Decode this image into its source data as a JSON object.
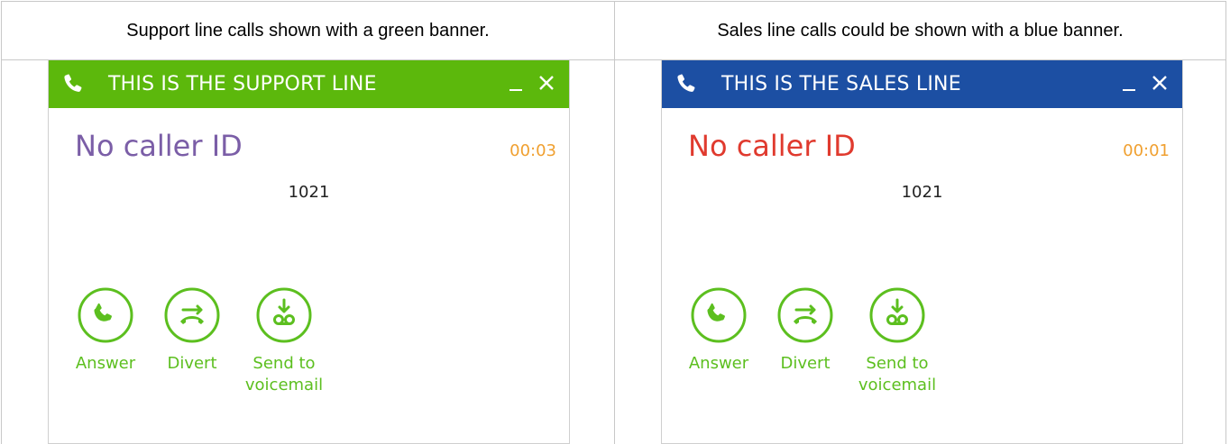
{
  "panels": [
    {
      "caption": "Support line calls shown with a green banner.",
      "banner_title": "THIS IS THE SUPPORT LINE",
      "banner_color": "#5cb80c",
      "caller_name": "No caller ID",
      "caller_name_color": "#7b5ea7",
      "timer": "00:03",
      "number": "1021",
      "actions": [
        {
          "label": "Answer",
          "icon": "answer-phone-icon"
        },
        {
          "label": "Divert",
          "icon": "divert-icon"
        },
        {
          "label": "Send to\nvoicemail",
          "icon": "voicemail-icon"
        }
      ]
    },
    {
      "caption": "Sales line calls could be shown with a blue banner.",
      "banner_title": "THIS IS THE SALES LINE",
      "banner_color": "#1c4fa3",
      "caller_name": "No caller ID",
      "caller_name_color": "#e03a2e",
      "timer": "00:01",
      "number": "1021",
      "actions": [
        {
          "label": "Answer",
          "icon": "answer-phone-icon"
        },
        {
          "label": "Divert",
          "icon": "divert-icon"
        },
        {
          "label": "Send to\nvoicemail",
          "icon": "voicemail-icon"
        }
      ]
    }
  ],
  "colors": {
    "action_green": "#5cbf1f",
    "timer_orange": "#f0a030"
  }
}
